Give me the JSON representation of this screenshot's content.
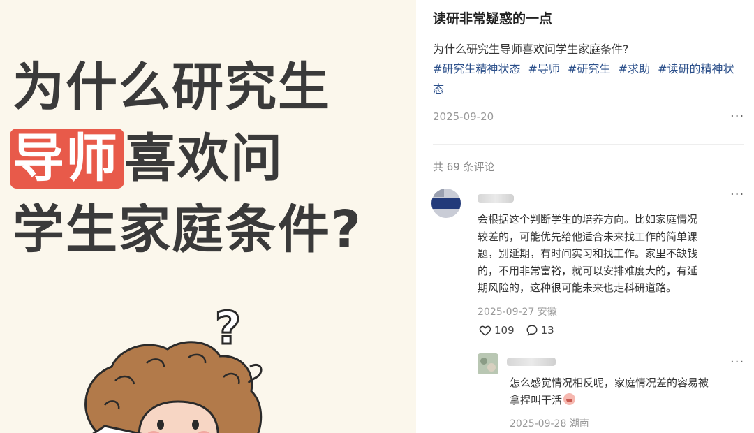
{
  "image_panel": {
    "line1": "为什么研究生",
    "line2_highlight": "导师",
    "line2_rest": "喜欢问",
    "line3": "学生家庭条件?",
    "question_mark": "?",
    "colors": {
      "background": "#fbf7ec",
      "highlight": "#e85a4a",
      "text": "#3a3a3a"
    }
  },
  "post": {
    "title": "读研非常疑惑的一点",
    "body": "为什么研究生导师喜欢问学生家庭条件?",
    "tags": [
      "#研究生精神状态",
      "#导师",
      "#研究生",
      "#求助",
      "#读研的精神状态"
    ],
    "date": "2025-09-20",
    "more_label": "···"
  },
  "comments": {
    "count_label": "共 69 条评论",
    "items": [
      {
        "text": "会根据这个判断学生的培养方向。比如家庭情况较差的，可能优先给他适合未来找工作的简单课题，别延期，有时间实习和找工作。家里不缺钱的，不用非常富裕，就可以安排难度大的，有延期风险的，这种很可能未来也走科研道路。",
        "lines": [
          "会根据这个判断学生的培养方向。比如家庭情况",
          "较差的，可能优先给他适合未来找工作的简单课",
          "题，别延期，有时间实习和找工作。家里不缺钱",
          "的，不用非常富裕，就可以安排难度大的，有延",
          "期风险的，这种很可能未来也走科研道路。"
        ],
        "meta": "2025-09-27 安徽",
        "likes": "109",
        "replies": "13",
        "more_label": "···"
      }
    ],
    "reply": {
      "lines": [
        "怎么感觉情况相反呢，家庭情况差的容易被",
        "拿捏叫干活"
      ],
      "meta": "2025-09-28 湖南",
      "more_label": "···"
    }
  },
  "icons": {
    "like": "heart-icon",
    "reply": "speech-bubble-icon",
    "more": "more-dots-icon"
  },
  "colors": {
    "tag": "#2b4f8a",
    "muted": "#999999"
  }
}
